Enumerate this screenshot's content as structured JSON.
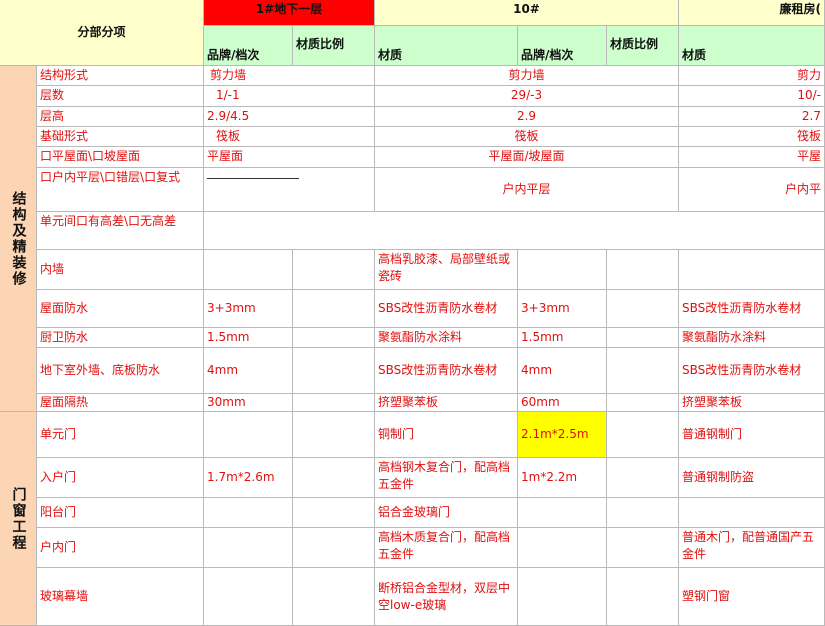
{
  "header": {
    "section_label": "分部分项",
    "col_group_1": "1#地下一层",
    "col_group_2": "10#",
    "col_group_3": "廉租房(",
    "sub_brand": "品牌/档次",
    "sub_ratio": "材质比例",
    "sub_material": "材质"
  },
  "sections": {
    "structure": "结构及精装修",
    "doors": "门窗工程"
  },
  "rows": [
    {
      "label": "结构形式",
      "g1": "剪力墙",
      "g2": "剪力墙",
      "g3": "剪力"
    },
    {
      "label": "层数",
      "g1": "1/-1",
      "g2": "29/-3",
      "g3": "10/-"
    },
    {
      "label": "层高",
      "g1": "2.9/4.5",
      "g2": "2.9",
      "g3": "2.7"
    },
    {
      "label": "基础形式",
      "g1": "筏板",
      "g2": "筏板",
      "g3": "筏板"
    },
    {
      "label": "口平屋面\\口坡屋面",
      "g1": "平屋面",
      "g2": "平屋面/坡屋面",
      "g3": "平屋"
    },
    {
      "label": "口户内平层\\口错层\\口复式",
      "g1": "",
      "g2": "户内平层",
      "g3": "户内平"
    },
    {
      "label": "单元间口有高差\\口无高差"
    },
    {
      "label": "内墙",
      "m10": "高档乳胶漆、局部壁纸或瓷砖"
    },
    {
      "label": "屋面防水",
      "b1": "3+3mm",
      "m10": "SBS改性沥青防水卷材",
      "b10": "3+3mm",
      "m3": "SBS改性沥青防水卷材"
    },
    {
      "label": "厨卫防水",
      "b1": "1.5mm",
      "m10": "聚氨酯防水涂料",
      "b10": "1.5mm",
      "m3": "聚氨酯防水涂料"
    },
    {
      "label": "地下室外墙、底板防水",
      "b1": "4mm",
      "m10": "SBS改性沥青防水卷材",
      "b10": "4mm",
      "m3": "SBS改性沥青防水卷材"
    },
    {
      "label": "屋面隔热",
      "b1": "30mm",
      "m10": "挤塑聚苯板",
      "b10": "60mm",
      "m3": "挤塑聚苯板"
    },
    {
      "label": "单元门",
      "m10": "铜制门",
      "b10": "2.1m*2.5m",
      "m3": "普通钢制门"
    },
    {
      "label": "入户门",
      "b1": "1.7m*2.6m",
      "m10": "高档钢木复合门，配高档五金件",
      "b10": "1m*2.2m",
      "m3": "普通钢制防盗"
    },
    {
      "label": "阳台门",
      "m10": "铝合金玻璃门"
    },
    {
      "label": "户内门",
      "m10": "高档木质复合门，配高档五金件",
      "m3": "普通木门，配普通国产五金件"
    },
    {
      "label": "玻璃幕墙",
      "m10": "断桥铝合金型材，双层中空low-e玻璃",
      "m3": "塑钢门窗"
    }
  ]
}
